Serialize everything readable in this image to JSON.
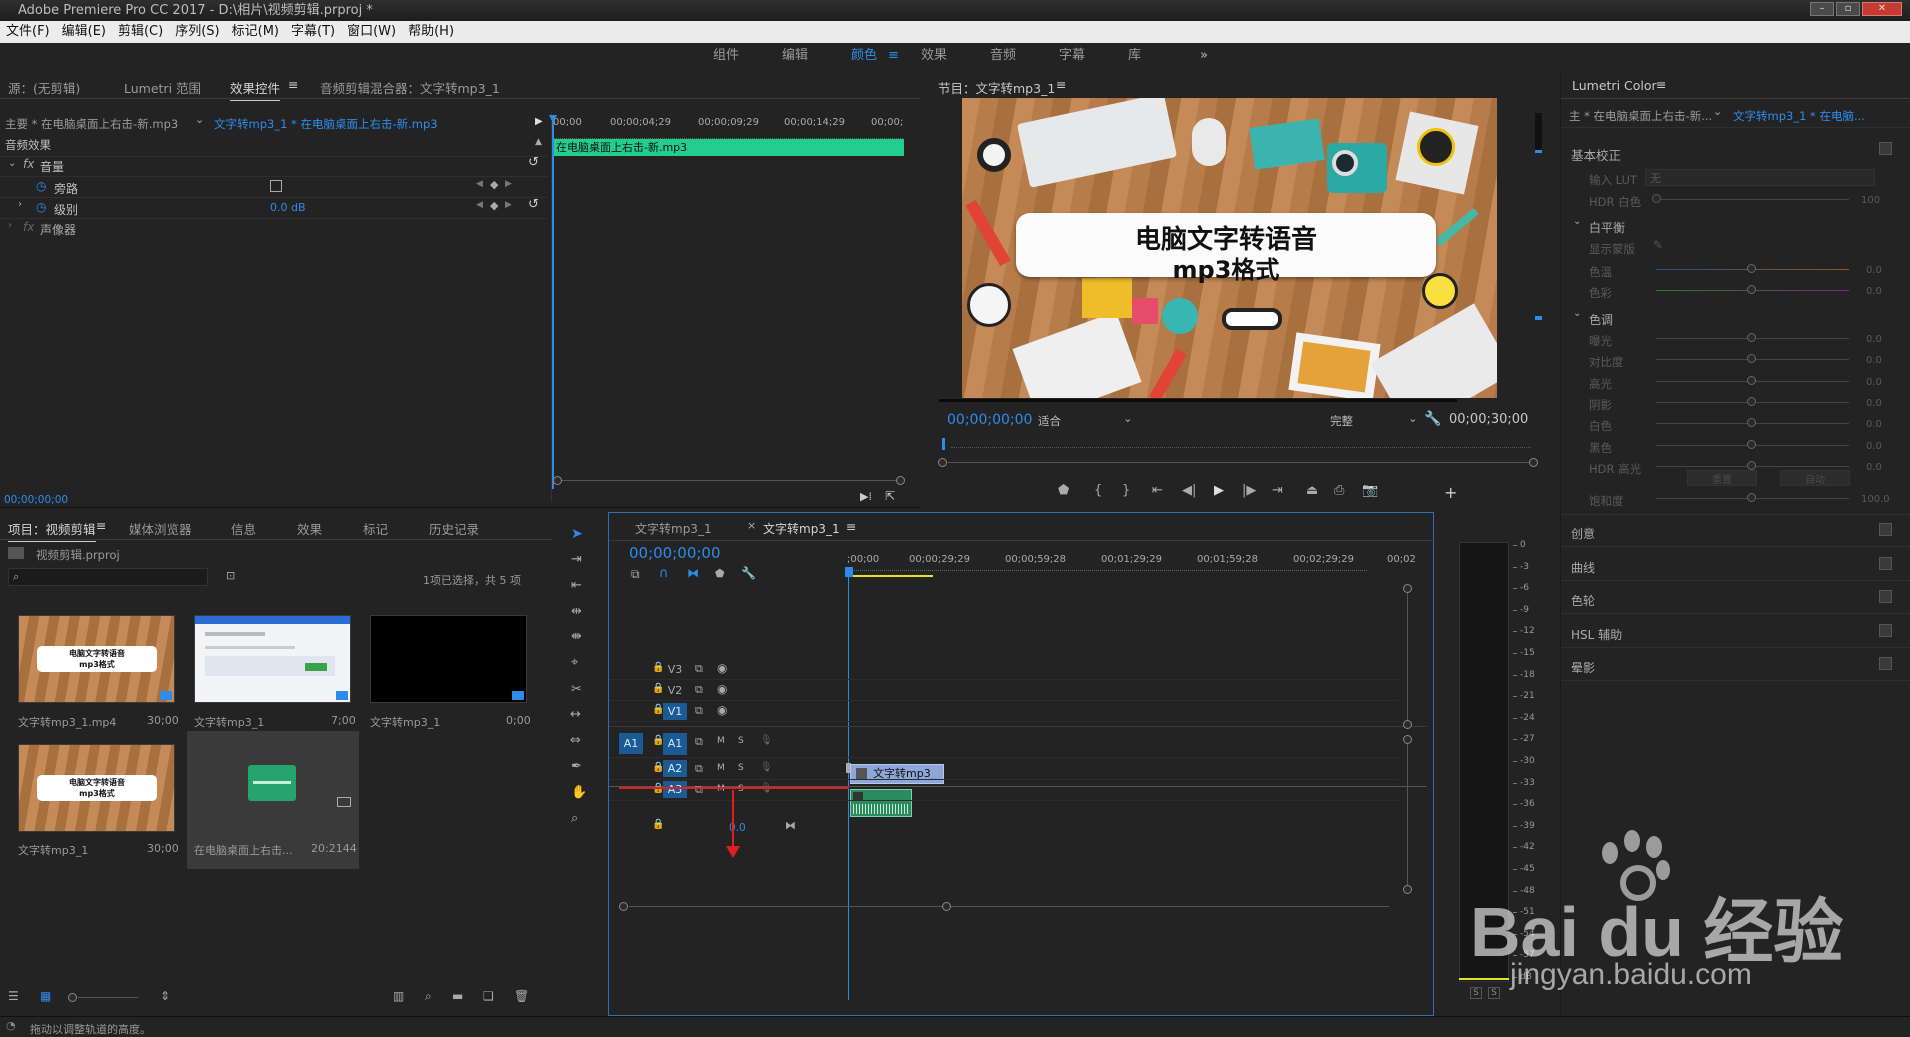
{
  "app": {
    "title": "Adobe Premiere Pro CC 2017 - D:\\相片\\视频剪辑.prproj *"
  },
  "menu": [
    "文件(F)",
    "编辑(E)",
    "剪辑(C)",
    "序列(S)",
    "标记(M)",
    "字幕(T)",
    "窗口(W)",
    "帮助(H)"
  ],
  "workspaces": [
    "组件",
    "编辑",
    "颜色",
    "效果",
    "音频",
    "字幕",
    "库"
  ],
  "workspace_active": "颜色",
  "source_panel": {
    "tabs": [
      "源：(无剪辑)",
      "Lumetri 范围",
      "效果控件",
      "音频剪辑混合器：文字转mp3_1"
    ],
    "active_tab": "效果控件",
    "master_clip": "主要 * 在电脑桌面上右击-新.mp3",
    "sequence_clip": "文字转mp3_1 * 在电脑桌面上右击-新.mp3",
    "time_ruler": [
      "00;00",
      "00;00;04;29",
      "00;00;09;29",
      "00;00;14;29",
      "00;00;"
    ],
    "clip_bar": "在电脑桌面上右击-新.mp3",
    "section": "音频效果",
    "effect": "音量",
    "rows": [
      {
        "name": "旁路",
        "value": ""
      },
      {
        "name": "级别",
        "value": "0.0 dB"
      }
    ],
    "panner": "声像器",
    "timecode": "00;00;00;00"
  },
  "program": {
    "title": "节目：文字转mp3_1",
    "video_title_line1": "电脑文字转语音",
    "video_title_line2": "mp3格式",
    "timecode": "00;00;00;00",
    "fit": "适合",
    "quality": "完整",
    "duration": "00;00;30;00"
  },
  "lumetri": {
    "title": "Lumetri Color",
    "master": "主 * 在电脑桌面上右击-新...",
    "sequence": "文字转mp3_1 * 在电脑...",
    "basic": "基本校正",
    "input_lut_label": "输入 LUT",
    "input_lut_value": "无",
    "hdr_label": "HDR 白色",
    "hdr_value": "100",
    "wb_section": "白平衡",
    "wb_show": "显示蒙版",
    "tone_section": "色调",
    "sliders": [
      {
        "name": "色温",
        "value": "0.0"
      },
      {
        "name": "色彩",
        "value": "0.0"
      }
    ],
    "tone_sliders": [
      {
        "name": "曝光",
        "value": "0.0"
      },
      {
        "name": "对比度",
        "value": "0.0"
      },
      {
        "name": "高光",
        "value": "0.0"
      },
      {
        "name": "阴影",
        "value": "0.0"
      },
      {
        "name": "白色",
        "value": "0.0"
      },
      {
        "name": "黑色",
        "value": "0.0"
      },
      {
        "name": "HDR 高光",
        "value": "0.0"
      }
    ],
    "reset": "重置",
    "auto": "自动",
    "saturation": {
      "name": "饱和度",
      "value": "100.0"
    },
    "sections": [
      "创意",
      "曲线",
      "色轮",
      "HSL 辅助",
      "晕影"
    ]
  },
  "project": {
    "tabs": [
      "项目：视频剪辑",
      "媒体浏览器",
      "信息",
      "效果",
      "标记",
      "历史记录"
    ],
    "file": "视频剪辑.prproj",
    "selection": "1项已选择，共 5 项",
    "items": [
      {
        "name": "文字转mp3_1.mp4",
        "duration": "30;00"
      },
      {
        "name": "文字转mp3_1",
        "duration": "7;00"
      },
      {
        "name": "文字转mp3_1",
        "duration": "0;00"
      },
      {
        "name": "文字转mp3_1",
        "duration": "30;00"
      },
      {
        "name": "在电脑桌面上右击...",
        "duration": "20:2144"
      }
    ],
    "thumb_title_line1": "电脑文字转语音",
    "thumb_title_line2": "mp3格式"
  },
  "timeline": {
    "tabs": [
      "文字转mp3_1",
      "文字转mp3_1"
    ],
    "timecode": "00;00;00;00",
    "ruler": [
      ";00;00",
      "00;00;29;29",
      "00;00;59;28",
      "00;01;29;29",
      "00;01;59;28",
      "00;02;29;29",
      "00;02"
    ],
    "video_tracks": [
      "V3",
      "V2",
      "V1"
    ],
    "audio_tracks": [
      "A1",
      "A2",
      "A3"
    ],
    "source_patch": "A1",
    "mute": "M",
    "solo": "S",
    "master_volume": "0.0",
    "clip_video": "文字转mp3_",
    "clip_audio": ""
  },
  "meter": {
    "ticks": [
      "0",
      "-3",
      "-6",
      "-9",
      "-12",
      "-15",
      "-18",
      "-21",
      "-24",
      "-27",
      "-30",
      "-33",
      "-36",
      "-39",
      "-42",
      "-45",
      "-48",
      "-51",
      "-54",
      "-57",
      "dB"
    ],
    "solo_labels": [
      "S",
      "S"
    ]
  },
  "status": {
    "text": "拖动以调整轨道的高度。"
  },
  "watermark": {
    "brand": "Bai du 经验",
    "url": "jingyan.baidu.com"
  },
  "colors": {
    "accent": "#2d8ceb",
    "clip_green": "#21cd8f",
    "playhead": "#2d8ceb",
    "marker_red": "#e02020"
  }
}
